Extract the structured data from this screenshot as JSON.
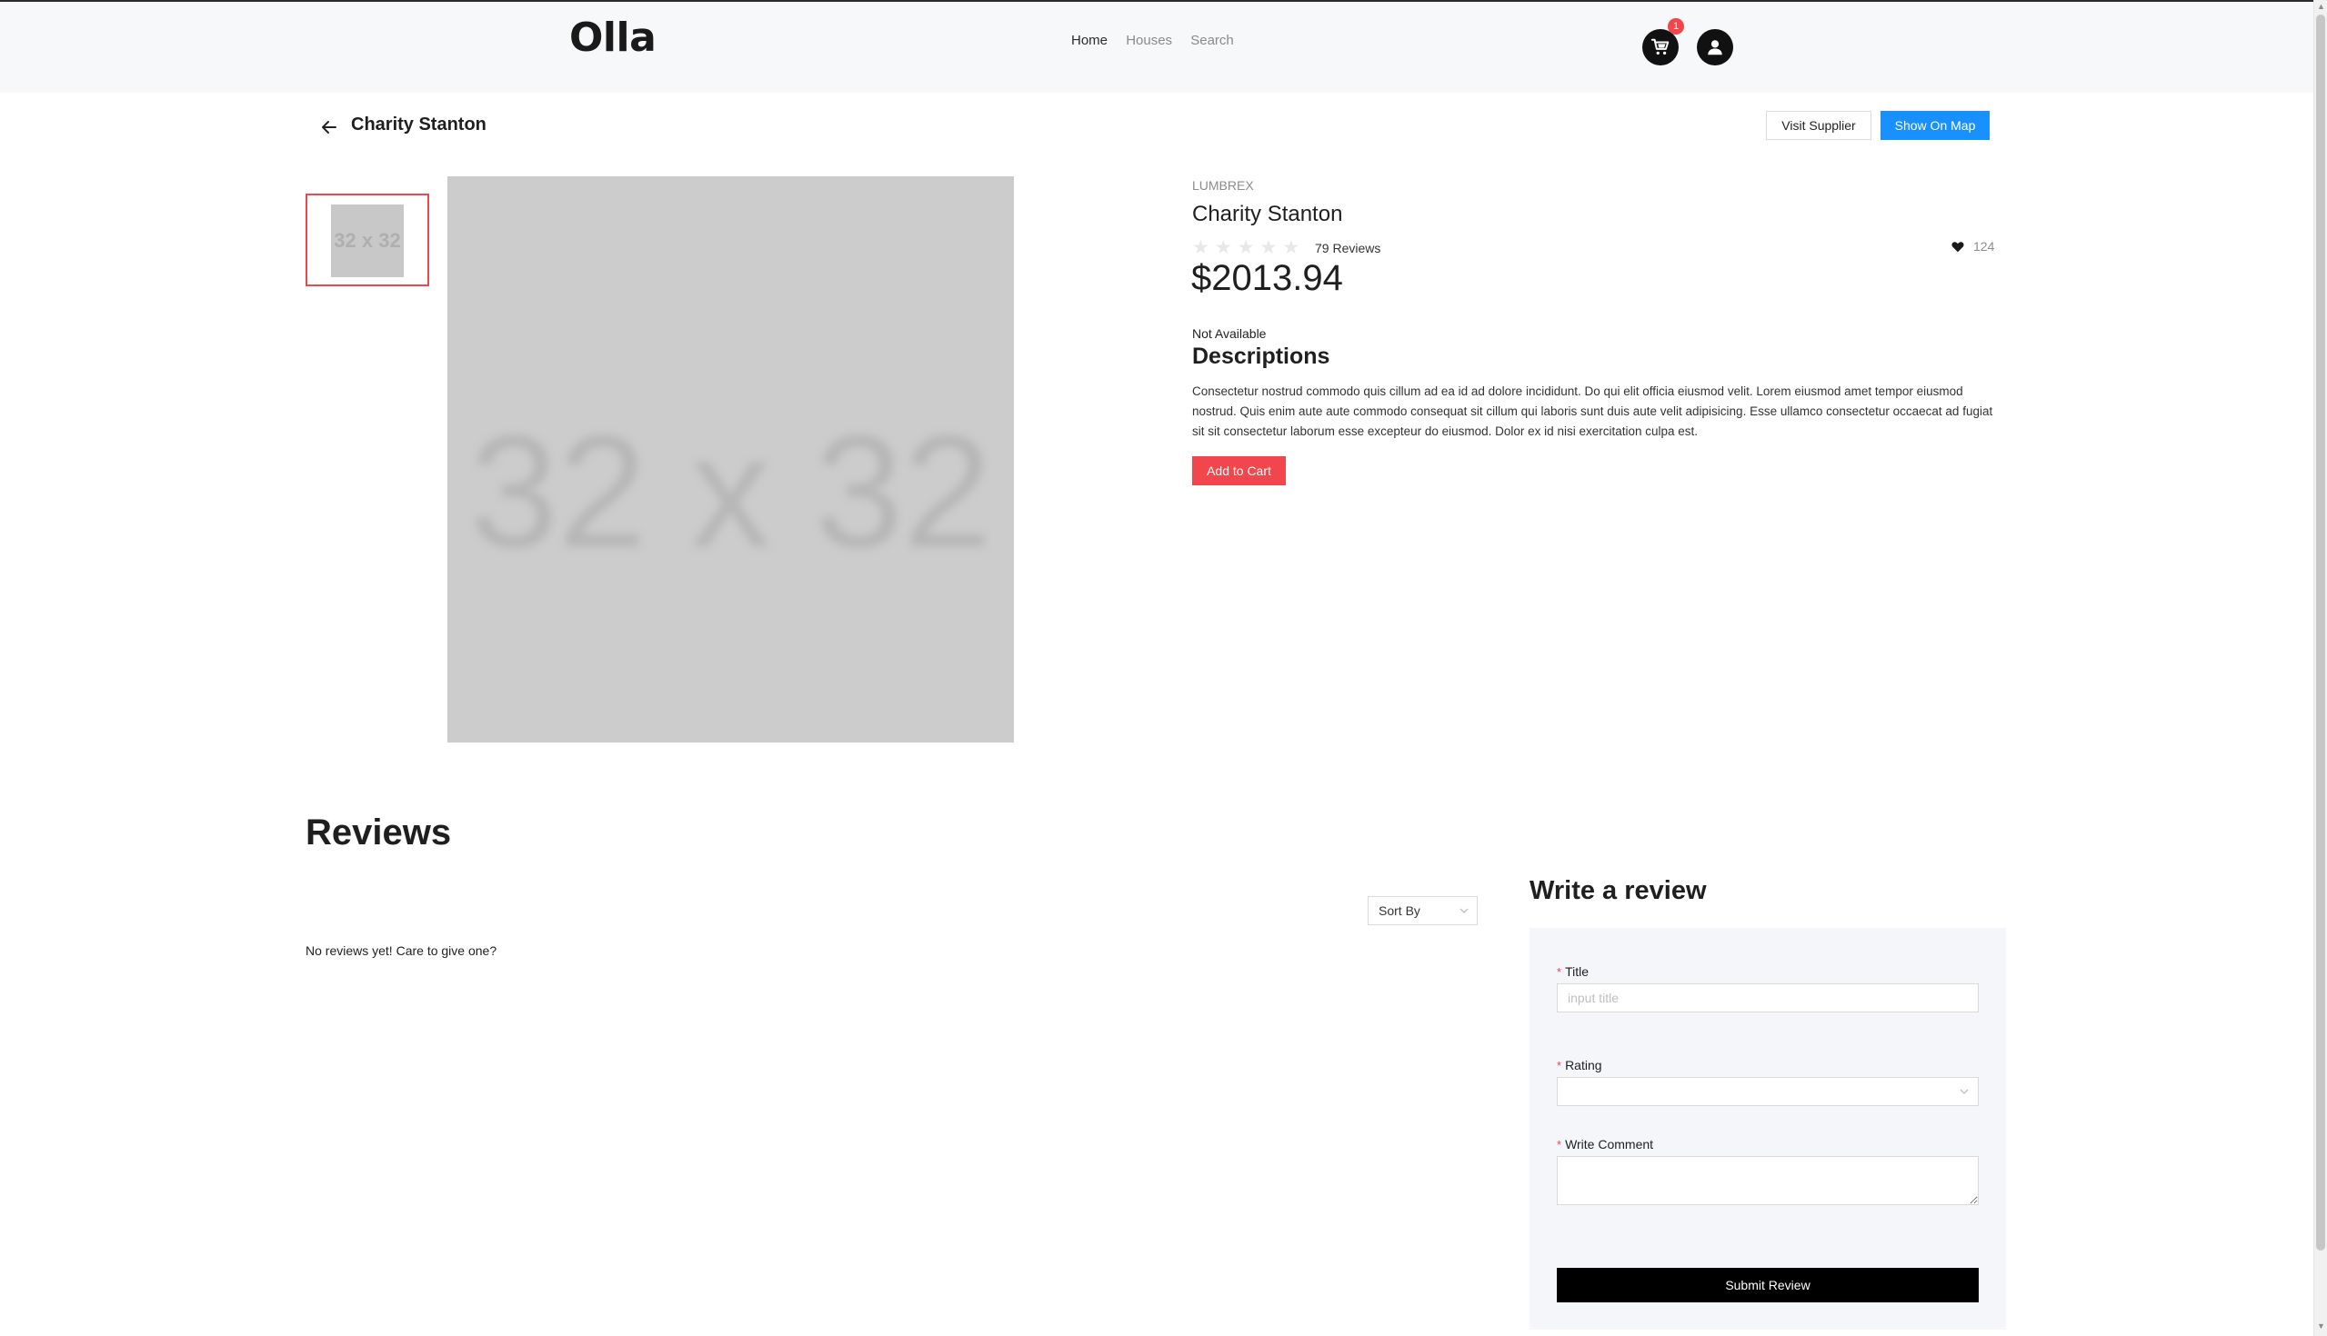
{
  "app": {
    "logo": "Olla"
  },
  "nav": {
    "items": [
      {
        "label": "Home",
        "active": true
      },
      {
        "label": "Houses",
        "active": false
      },
      {
        "label": "Search",
        "active": false
      }
    ]
  },
  "header": {
    "cart_badge": "1",
    "icons": [
      "cart-icon",
      "user-icon"
    ]
  },
  "page": {
    "title": "Charity Stanton",
    "visit_supplier_label": "Visit Supplier",
    "show_on_map_label": "Show On Map"
  },
  "gallery": {
    "thumbnail_text": "32 x 32",
    "main_image_text": "32 x 32"
  },
  "product": {
    "brand": "LUMBREX",
    "name": "Charity Stanton",
    "rating": 0,
    "rating_max": 5,
    "reviews_count": "79 Reviews",
    "likes": "124",
    "price": "$2013.94",
    "availability": "Not Available",
    "description_title": "Descriptions",
    "description": "Consectetur nostrud commodo quis cillum ad ea id ad dolore incididunt. Do qui elit officia eiusmod velit. Lorem eiusmod amet tempor eiusmod nostrud. Quis enim aute aute commodo consequat sit cillum qui laboris sunt duis aute velit adipisicing. Esse ullamco consectetur occaecat ad fugiat sit sit consectetur laborum esse excepteur do eiusmod. Dolor ex id nisi exercitation culpa est.",
    "add_to_cart_label": "Add to Cart"
  },
  "reviews": {
    "title": "Reviews",
    "sort_label": "Sort By",
    "empty_text": "No reviews yet! Care to give one?"
  },
  "review_form": {
    "title": "Write a review",
    "title_label": "Title",
    "title_placeholder": "input title",
    "rating_label": "Rating",
    "comment_label": "Write Comment",
    "required_mark": "*",
    "submit_label": "Submit Review"
  },
  "colors": {
    "accent": "#f0464c",
    "primary": "#1890ff",
    "header_bg": "#f7f8fa",
    "form_bg": "#f4f6f9"
  }
}
